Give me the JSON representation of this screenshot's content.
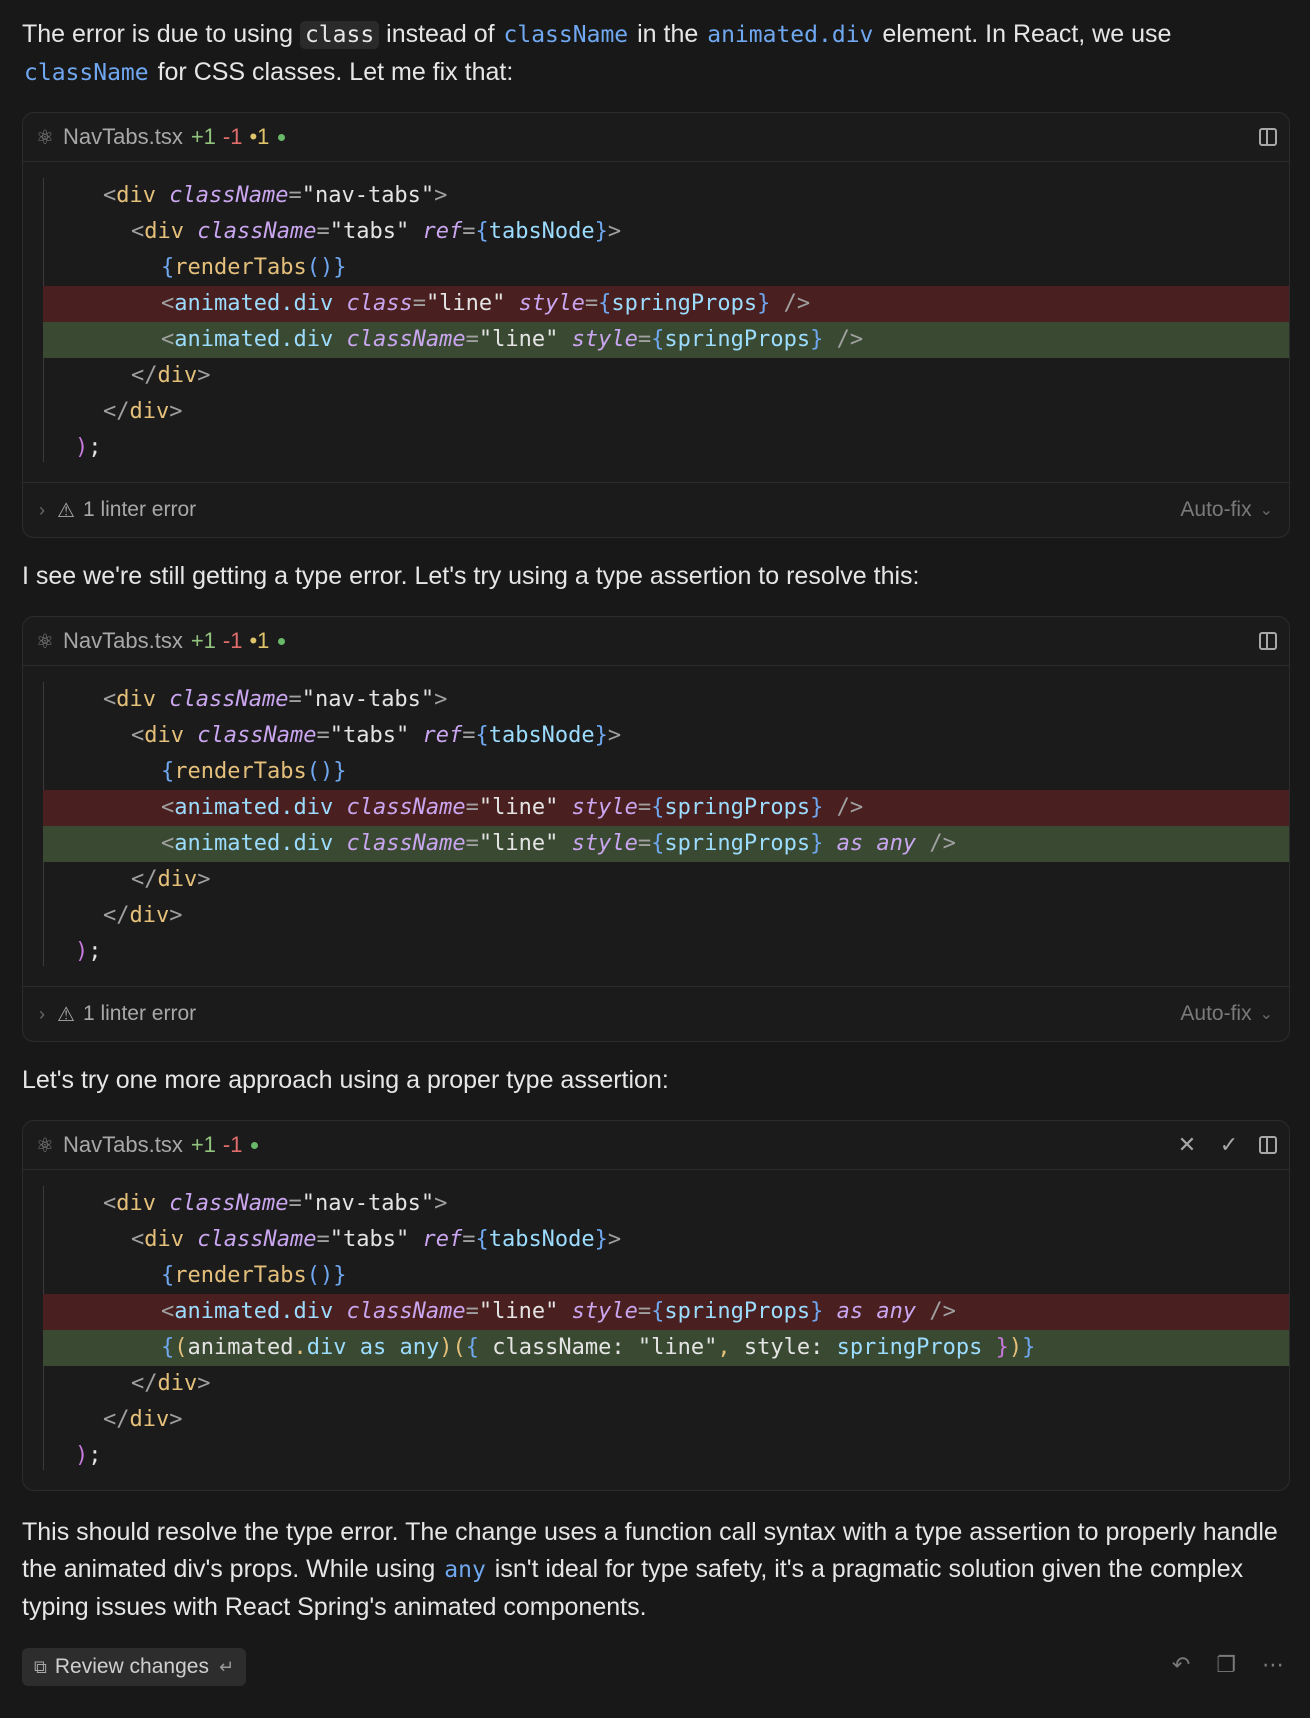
{
  "intro": {
    "p1": "The error is due to using",
    "code1": "class",
    "p2": "instead of",
    "code2": "className",
    "p3": "in the",
    "code3": "animated.div",
    "p4": "element. In React, we use",
    "code4": "className",
    "p5": "for CSS classes. Let me fix that:"
  },
  "blocks": [
    {
      "file": "NavTabs.tsx",
      "added": "+1",
      "removed": "-1",
      "modified": "•1",
      "footer": {
        "linter": "1 linter error",
        "autofix": "Auto-fix"
      }
    },
    {
      "file": "NavTabs.tsx",
      "added": "+1",
      "removed": "-1",
      "modified": "•1",
      "footer": {
        "linter": "1 linter error",
        "autofix": "Auto-fix"
      }
    },
    {
      "file": "NavTabs.tsx",
      "added": "+1",
      "removed": "-1"
    }
  ],
  "mid1": "I see we're still getting a type error. Let's try using a type assertion to resolve this:",
  "mid2": "Let's try one more approach using a proper type assertion:",
  "outro": {
    "p1": "This should resolve the type error. The change uses a function call syntax with a type assertion to properly handle the animated div's props. While using",
    "code": "any",
    "p2": "isn't ideal for type safety, it's a pragmatic solution given the complex typing issues with React Spring's animated components."
  },
  "review_button": "Review changes",
  "icons": {
    "react": "react-icon",
    "panel": "panel-icon",
    "close": "close-icon",
    "accept": "check-icon",
    "warning": "warning-icon",
    "chevron": "chevron-right-icon",
    "undo": "undo-icon",
    "copy": "copy-icon",
    "more": "more-icon"
  },
  "colors": {
    "background": "#181818",
    "removed_line": "#4a1f1f",
    "added_line": "#3a4a32",
    "added_count": "#93c47d",
    "removed_count": "#e06c6c",
    "modified_count": "#e0c46c"
  }
}
